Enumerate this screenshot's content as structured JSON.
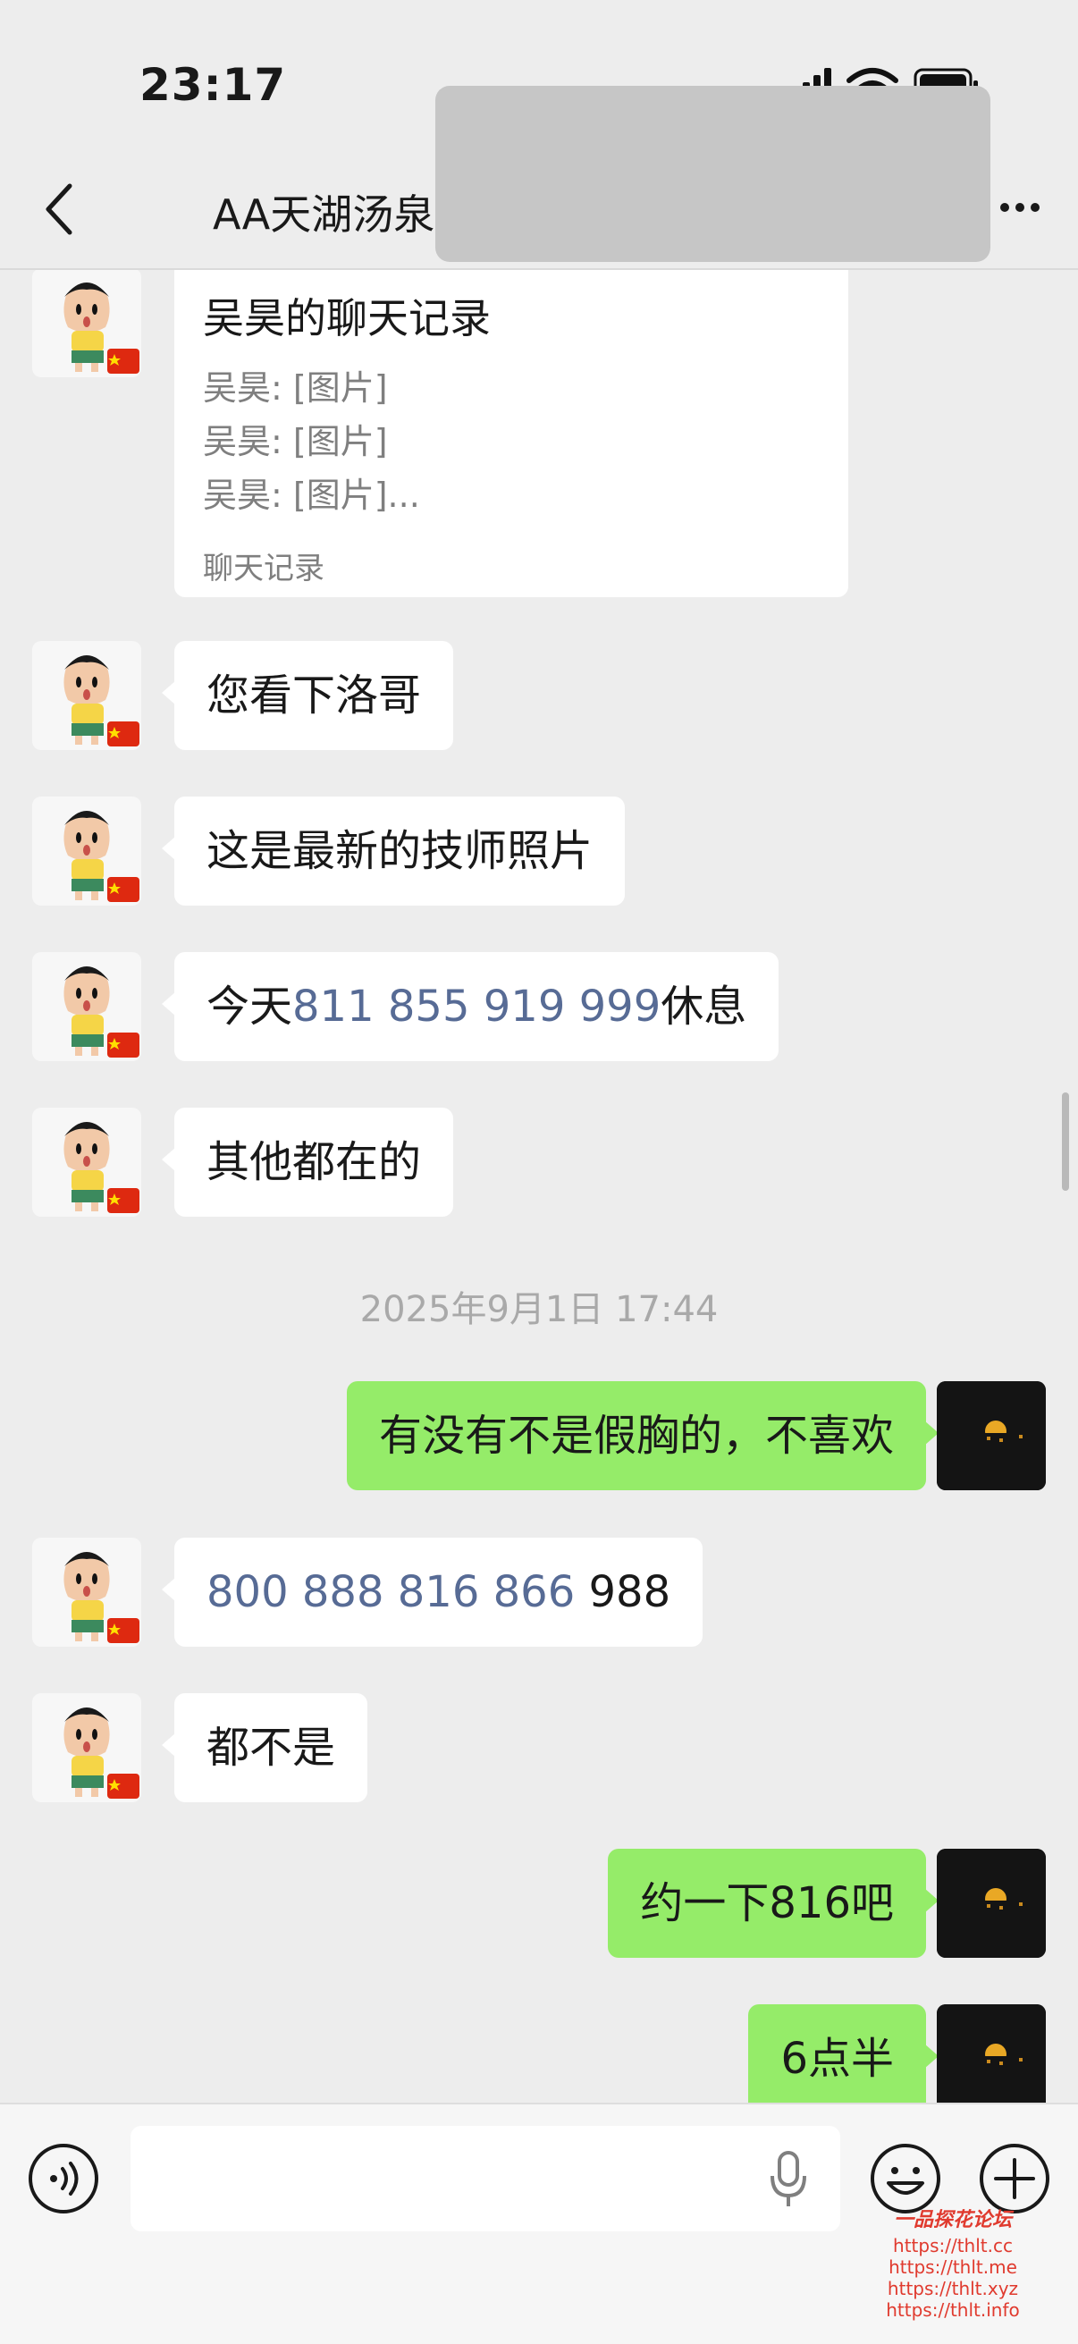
{
  "status": {
    "time": "23:17"
  },
  "nav": {
    "title": "AA天湖汤泉",
    "back_icon": "chevron-left-icon",
    "more_icon": "ellipsis-icon"
  },
  "chat": {
    "record_card": {
      "title": "吴昊的聊天记录",
      "lines": [
        "吴昊: [图片]",
        "吴昊: [图片]",
        "吴昊: [图片]..."
      ],
      "footer": "聊天记录"
    },
    "messages": [
      {
        "side": "in",
        "text": "您看下洛哥"
      },
      {
        "side": "in",
        "text": "这是最新的技师照片"
      },
      {
        "side": "in",
        "prefix": "今天",
        "link": "811 855 919 999",
        "suffix": "休息"
      },
      {
        "side": "in",
        "text": "其他都在的"
      },
      {
        "side": "out",
        "text": "有没有不是假胸的，不喜欢"
      },
      {
        "side": "in",
        "link": "800 888 816 866",
        "suffix": " 988"
      },
      {
        "side": "in",
        "text": "都不是"
      },
      {
        "side": "out",
        "text": "约一下816吧"
      },
      {
        "side": "out",
        "text": "6点半"
      }
    ],
    "timestamp": "2025年9月1日 17:44"
  },
  "input_bar": {
    "voice_icon": "voice-icon",
    "mic_icon": "microphone-icon",
    "emoji_icon": "emoji-icon",
    "plus_icon": "plus-icon"
  },
  "watermark": {
    "title": "一品探花论坛",
    "urls": [
      "https://thlt.cc",
      "https://thlt.me",
      "https://thlt.xyz",
      "https://thlt.info"
    ]
  },
  "colors": {
    "background": "#ededed",
    "bubble_out": "#95ec69",
    "bubble_in": "#ffffff",
    "link": "#576b95"
  }
}
